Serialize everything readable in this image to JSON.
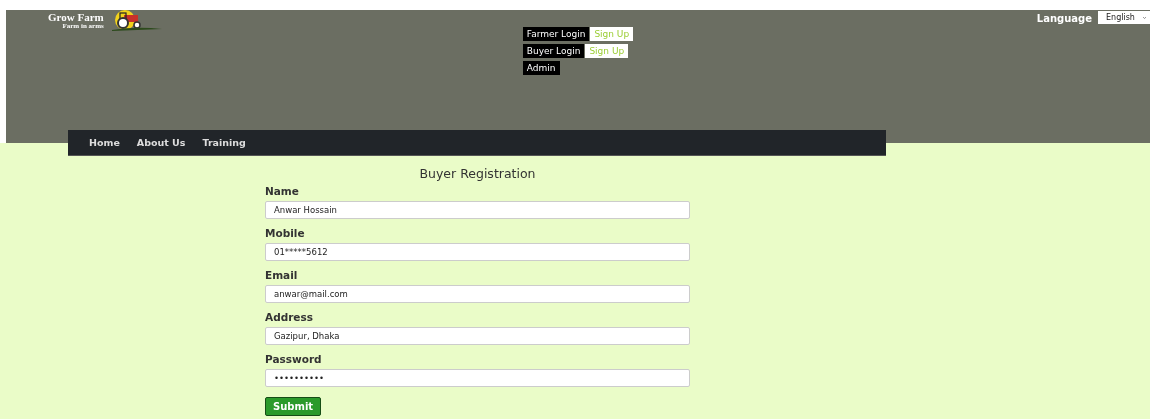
{
  "logo": {
    "title": "Grow Farm",
    "tagline": "Farm in arms"
  },
  "language": {
    "label": "Language",
    "value": "English"
  },
  "auth_links": [
    {
      "login": "Farmer Login",
      "signup": "Sign Up"
    },
    {
      "login": "Buyer Login",
      "signup": "Sign Up"
    },
    {
      "login": "Admin"
    }
  ],
  "nav": [
    "Home",
    "About Us",
    "Training"
  ],
  "form": {
    "title": "Buyer Registration",
    "fields": [
      {
        "label": "Name",
        "value": "Anwar Hossain"
      },
      {
        "label": "Mobile",
        "value": "01*****5612"
      },
      {
        "label": "Email",
        "value": "anwar@mail.com"
      },
      {
        "label": "Address",
        "value": "Gazipur, Dhaka"
      },
      {
        "label": "Password",
        "value": "••••••••••"
      }
    ],
    "submit": "Submit"
  }
}
